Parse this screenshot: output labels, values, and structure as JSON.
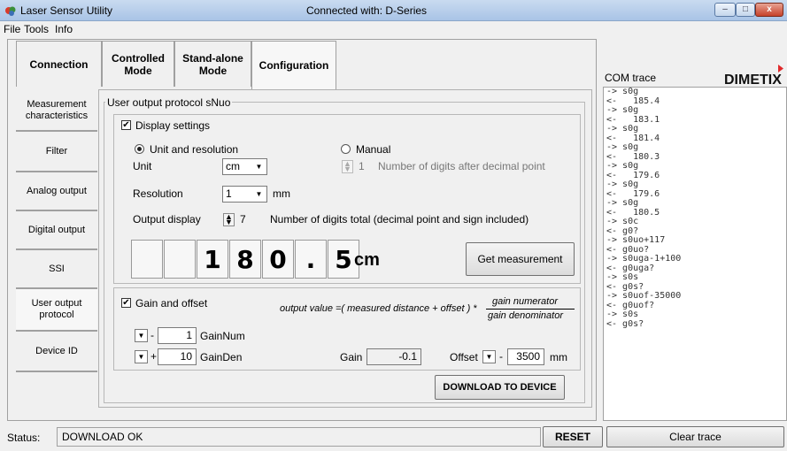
{
  "window": {
    "title": "Laser Sensor Utility",
    "connection_status": "Connected with: D-Series",
    "min": "–",
    "max": "□",
    "close": "x"
  },
  "menu": {
    "file": "File",
    "tools": "Tools",
    "info": "Info"
  },
  "top_tabs": [
    {
      "line1": "Connection",
      "line2": ""
    },
    {
      "line1": "Controlled",
      "line2": "Mode"
    },
    {
      "line1": "Stand-alone",
      "line2": "Mode"
    },
    {
      "line1": "Configuration",
      "line2": ""
    }
  ],
  "side_tabs": [
    {
      "line1": "Measurement",
      "line2": "characteristics"
    },
    {
      "line1": "Filter",
      "line2": ""
    },
    {
      "line1": "Analog output",
      "line2": ""
    },
    {
      "line1": "Digital output",
      "line2": ""
    },
    {
      "line1": "SSI",
      "line2": ""
    },
    {
      "line1": "User output",
      "line2": "protocol"
    },
    {
      "line1": "Device ID",
      "line2": ""
    }
  ],
  "protocol": {
    "group_title": "User output protocol sNuo",
    "display_settings_label": "Display settings",
    "display_settings_checked": "✔",
    "unit_resolution_label": "Unit and resolution",
    "manual_label": "Manual",
    "unit_label": "Unit",
    "unit_value": "cm",
    "manual_digits_value": "1",
    "manual_digits_label": "Number of digits after decimal point",
    "resolution_label": "Resolution",
    "resolution_value": "1",
    "resolution_unit": "mm",
    "output_display_label": "Output display",
    "output_display_value": "7",
    "output_display_desc": "Number of digits total (decimal point and sign included)",
    "digits": [
      "",
      "",
      "1",
      "8",
      "0",
      ".",
      "5"
    ],
    "display_unit": "cm",
    "get_measurement_button": "Get measurement",
    "gain_offset_label": "Gain and offset",
    "gain_offset_checked": "✔",
    "formula_prefix": "output value =( measured distance + offset ) *",
    "formula_numerator": "gain numerator",
    "formula_denominator": "gain denominator",
    "gain_num_sign": "-",
    "gain_num_value": "1",
    "gain_num_label": "GainNum",
    "gain_den_sign": "+",
    "gain_den_value": "10",
    "gain_den_label": "GainDen",
    "gain_label": "Gain",
    "gain_value": "-0.1",
    "offset_label": "Offset",
    "offset_sign": "-",
    "offset_value": "3500",
    "offset_unit": "mm",
    "download_button": "DOWNLOAD TO DEVICE"
  },
  "com_trace": {
    "title": "COM trace",
    "logo_text": "DIMETIX",
    "lines": [
      "-> s0g",
      "<-   185.4",
      "-> s0g",
      "<-   183.1",
      "-> s0g",
      "<-   181.4",
      "-> s0g",
      "<-   180.3",
      "-> s0g",
      "<-   179.6",
      "-> s0g",
      "<-   179.6",
      "-> s0g",
      "<-   180.5",
      "-> s0c",
      "<- g0?",
      "-> s0uo+117",
      "<- g0uo?",
      "-> s0uga-1+100",
      "<- g0uga?",
      "-> s0s",
      "<- g0s?",
      "-> s0uof-35000",
      "<- g0uof?",
      "-> s0s",
      "<- g0s?"
    ],
    "clear_button": "Clear trace"
  },
  "status": {
    "label": "Status:",
    "value": "DOWNLOAD OK",
    "reset_button": "RESET"
  },
  "colors": {
    "logo_red": "#e0292b",
    "accent": "#3b6fb6"
  }
}
